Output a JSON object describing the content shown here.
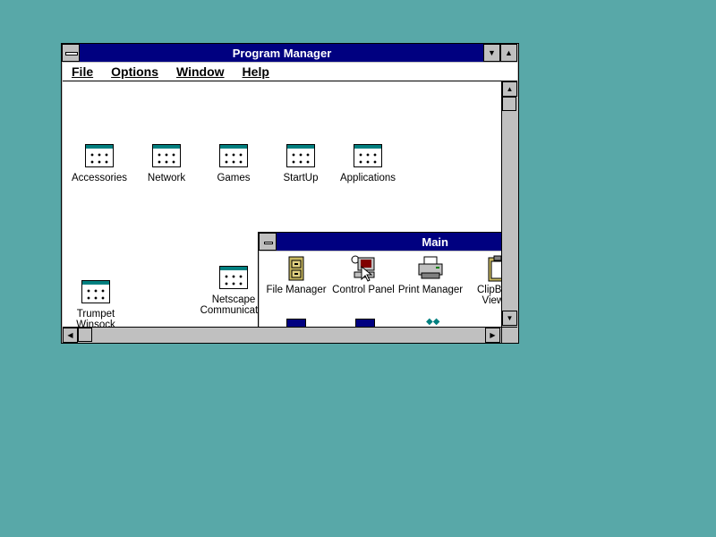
{
  "program_manager": {
    "title": "Program Manager",
    "menu": [
      "File",
      "Options",
      "Window",
      "Help"
    ],
    "groups": [
      {
        "label": "Accessories"
      },
      {
        "label": "Network"
      },
      {
        "label": "Games"
      },
      {
        "label": "StartUp"
      },
      {
        "label": "Applications"
      },
      {
        "label": "Trumpet Winsock"
      },
      {
        "label": "Netscape Communicator"
      }
    ]
  },
  "main_window": {
    "title": "Main",
    "programs": [
      {
        "label": "File Manager",
        "icon": "file-cabinet-icon"
      },
      {
        "label": "Control Panel",
        "icon": "control-panel-icon"
      },
      {
        "label": "Print Manager",
        "icon": "printer-icon"
      },
      {
        "label": "ClipBook Viewer",
        "icon": "clipboard-icon"
      }
    ]
  },
  "colors": {
    "desktop": "#58a8a8",
    "titlebar": "#000080",
    "chrome": "#c0c0c0"
  }
}
